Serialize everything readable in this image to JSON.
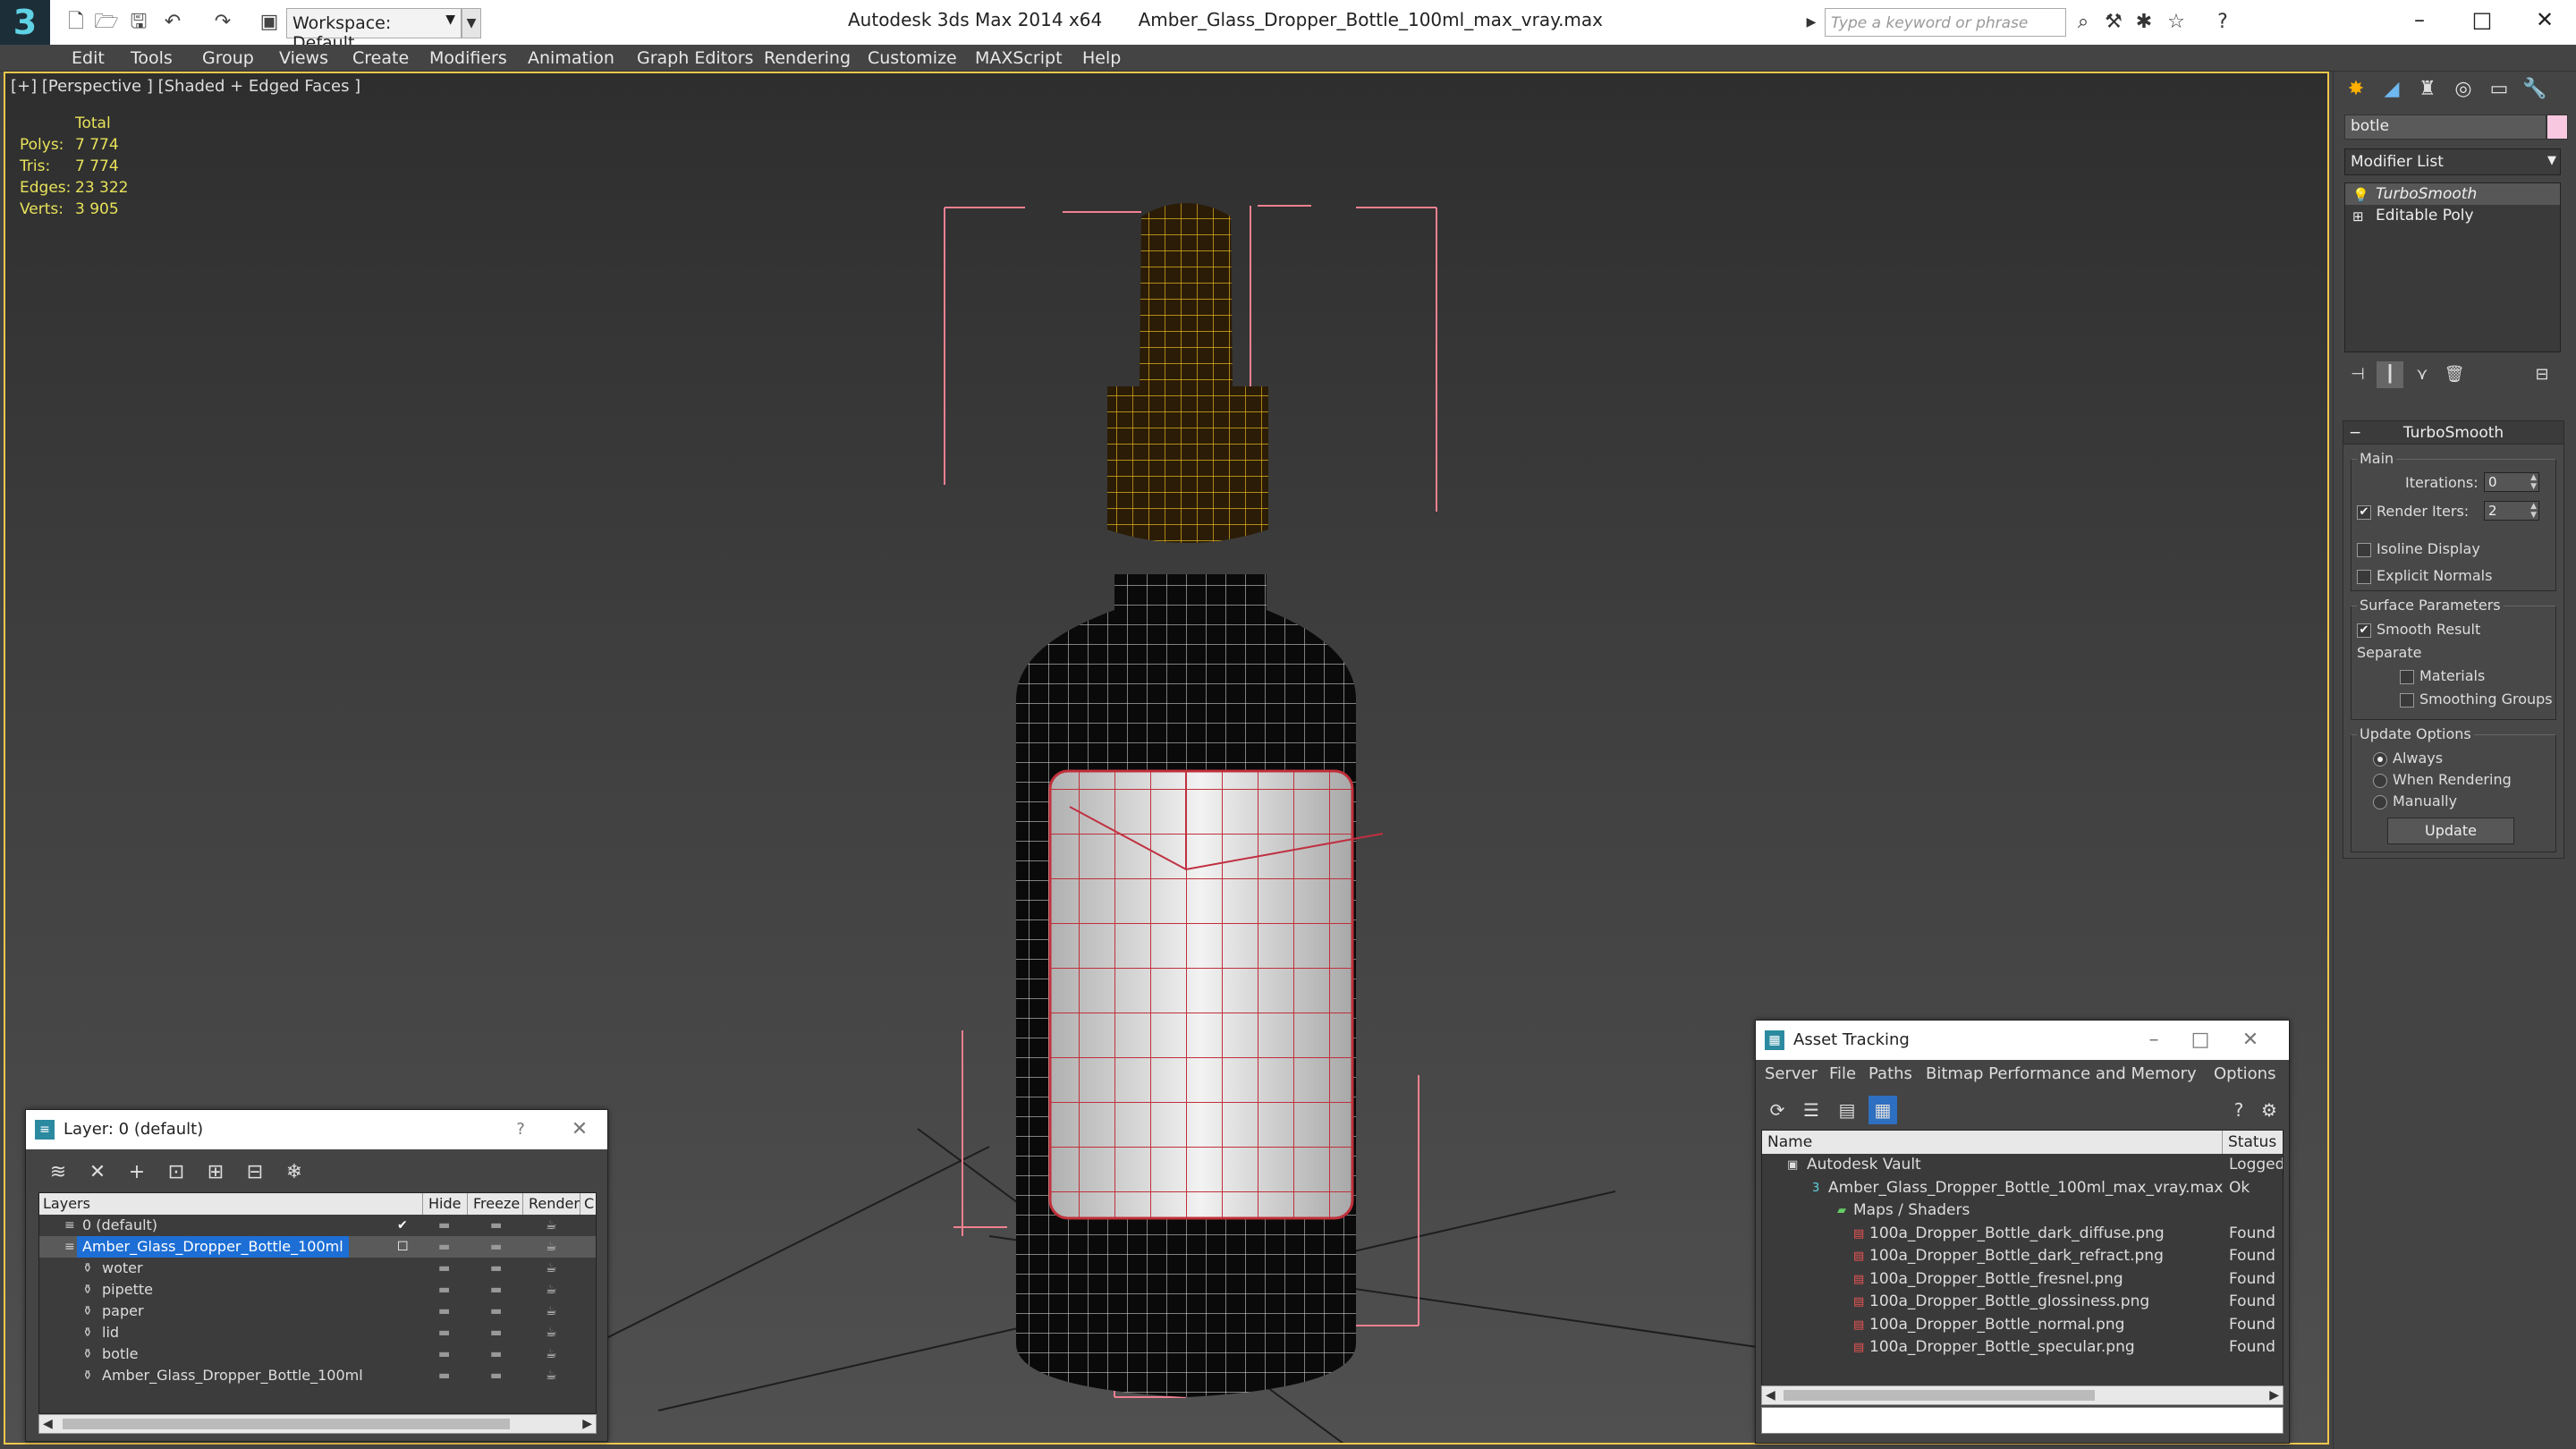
{
  "app": {
    "title": "Autodesk 3ds Max  2014 x64",
    "file": "Amber_Glass_Dropper_Bottle_100ml_max_vray.max",
    "workspace": "Workspace: Default",
    "search_placeholder": "Type a keyword or phrase"
  },
  "menu": [
    "Edit",
    "Tools",
    "Group",
    "Views",
    "Create",
    "Modifiers",
    "Animation",
    "Graph Editors",
    "Rendering",
    "Customize",
    "MAXScript",
    "Help"
  ],
  "viewport": {
    "label": "[+] [Perspective ] [Shaded + Edged Faces ]",
    "stats": {
      "header": "Total",
      "rows": [
        {
          "label": "Polys:",
          "value": "7 774"
        },
        {
          "label": "Tris:",
          "value": "7 774"
        },
        {
          "label": "Edges:",
          "value": "23 322"
        },
        {
          "label": "Verts:",
          "value": "3 905"
        }
      ]
    }
  },
  "command_panel": {
    "object_name": "botle",
    "object_color": "#f8c8e0",
    "modifier_list": "Modifier List",
    "stack": [
      {
        "label": "TurboSmooth",
        "selected": true
      },
      {
        "label": "Editable Poly",
        "selected": false
      }
    ],
    "turbosmooth": {
      "title": "TurboSmooth",
      "main_group": "Main",
      "iterations_label": "Iterations:",
      "iterations_value": "0",
      "render_iters_label": "Render Iters:",
      "render_iters_value": "2",
      "isoline_label": "Isoline Display",
      "explicit_normals_label": "Explicit Normals",
      "surface_group": "Surface Parameters",
      "smooth_result_label": "Smooth Result",
      "separate_label": "Separate",
      "materials_label": "Materials",
      "smoothing_groups_label": "Smoothing Groups",
      "update_group": "Update Options",
      "always_label": "Always",
      "when_rendering_label": "When Rendering",
      "manually_label": "Manually",
      "update_button": "Update"
    }
  },
  "layer_dialog": {
    "title": "Layer: 0 (default)",
    "help": "?",
    "columns": {
      "layers": "Layers",
      "hide": "Hide",
      "freeze": "Freeze",
      "render": "Render",
      "c": "C"
    },
    "rows": [
      {
        "name": "0 (default)",
        "indent": 1,
        "type": "layer"
      },
      {
        "name": "Amber_Glass_Dropper_Bottle_100ml",
        "indent": 1,
        "type": "layer",
        "selected": true
      },
      {
        "name": "woter",
        "indent": 2,
        "type": "object"
      },
      {
        "name": "pipette",
        "indent": 2,
        "type": "object"
      },
      {
        "name": "paper",
        "indent": 2,
        "type": "object"
      },
      {
        "name": "lid",
        "indent": 2,
        "type": "object"
      },
      {
        "name": "botle",
        "indent": 2,
        "type": "object"
      },
      {
        "name": "Amber_Glass_Dropper_Bottle_100ml",
        "indent": 2,
        "type": "object"
      }
    ]
  },
  "asset_dialog": {
    "title": "Asset Tracking",
    "menu": [
      "Server",
      "File",
      "Paths",
      "Bitmap Performance and Memory",
      "Options"
    ],
    "columns": {
      "name": "Name",
      "status": "Status"
    },
    "rows": [
      {
        "name": "Autodesk Vault",
        "status": "Logged",
        "indent": 0,
        "icon": "vault"
      },
      {
        "name": "Amber_Glass_Dropper_Bottle_100ml_max_vray.max",
        "status": "Ok",
        "indent": 1,
        "icon": "max"
      },
      {
        "name": "Maps / Shaders",
        "status": "",
        "indent": 2,
        "icon": "folder"
      },
      {
        "name": "100a_Dropper_Bottle_dark_diffuse.png",
        "status": "Found",
        "indent": 3,
        "icon": "png"
      },
      {
        "name": "100a_Dropper_Bottle_dark_refract.png",
        "status": "Found",
        "indent": 3,
        "icon": "png"
      },
      {
        "name": "100a_Dropper_Bottle_fresnel.png",
        "status": "Found",
        "indent": 3,
        "icon": "png"
      },
      {
        "name": "100a_Dropper_Bottle_glossiness.png",
        "status": "Found",
        "indent": 3,
        "icon": "png"
      },
      {
        "name": "100a_Dropper_Bottle_normal.png",
        "status": "Found",
        "indent": 3,
        "icon": "png"
      },
      {
        "name": "100a_Dropper_Bottle_specular.png",
        "status": "Found",
        "indent": 3,
        "icon": "png"
      }
    ]
  }
}
